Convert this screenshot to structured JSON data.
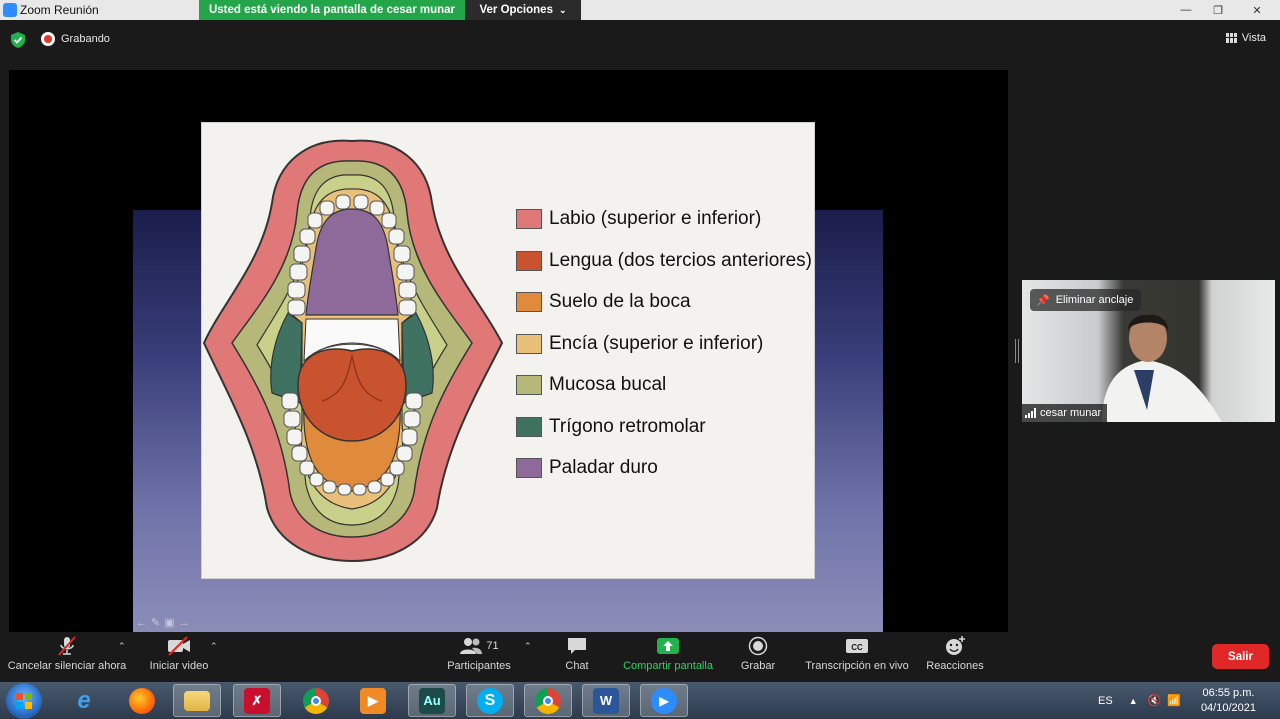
{
  "window": {
    "title": "Zoom Reunión",
    "share_banner": "Usted está viendo la pantalla de cesar munar",
    "view_options": "Ver Opciones"
  },
  "status": {
    "recording_label": "Grabando",
    "view_label": "Vista"
  },
  "slide": {
    "legend": [
      {
        "label": "Labio (superior e inferior)",
        "color": "#e07878"
      },
      {
        "label": "Lengua (dos tercios anteriores)",
        "color": "#c9532f"
      },
      {
        "label": "Suelo de la boca",
        "color": "#e08a3c"
      },
      {
        "label": "Encía (superior e inferior)",
        "color": "#e8c07a"
      },
      {
        "label": "Mucosa bucal",
        "color": "#b5b878"
      },
      {
        "label": "Trígono retromolar",
        "color": "#3f7260"
      },
      {
        "label": "Paladar duro",
        "color": "#8e6a9a"
      }
    ]
  },
  "participant": {
    "unpin_label": "Eliminar anclaje",
    "name": "cesar munar"
  },
  "toolbar": {
    "unmute_label": "Cancelar silenciar ahora",
    "video_label": "Iniciar video",
    "participants_label": "Participantes",
    "participants_count": "71",
    "chat_label": "Chat",
    "share_label": "Compartir pantalla",
    "record_label": "Grabar",
    "transcription_label": "Transcripción en vivo",
    "reactions_label": "Reacciones",
    "leave_label": "Salir"
  },
  "taskbar": {
    "language": "ES",
    "time": "06:55 p.m.",
    "date": "04/10/2021",
    "audition_label": "Au",
    "word_label": "W"
  },
  "colors": {
    "share_green": "#23a64a",
    "leave_red": "#e02828",
    "zoom_blue": "#2d8cff"
  }
}
